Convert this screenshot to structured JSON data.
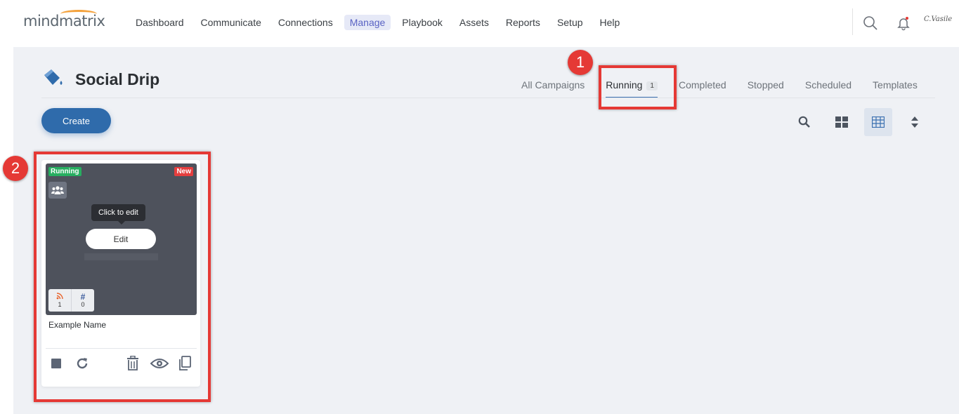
{
  "brand": {
    "logo_text": "mindmatrix",
    "signature_text": "C.Vasile"
  },
  "nav": {
    "items": [
      {
        "label": "Dashboard",
        "active": false
      },
      {
        "label": "Communicate",
        "active": false
      },
      {
        "label": "Connections",
        "active": false
      },
      {
        "label": "Manage",
        "active": true
      },
      {
        "label": "Playbook",
        "active": false
      },
      {
        "label": "Assets",
        "active": false
      },
      {
        "label": "Reports",
        "active": false
      },
      {
        "label": "Setup",
        "active": false
      },
      {
        "label": "Help",
        "active": false
      }
    ],
    "icons": [
      "search-icon",
      "bell-icon",
      "signature-avatar"
    ]
  },
  "page": {
    "title": "Social Drip",
    "title_icon": "paint-bucket-icon",
    "create_label": "Create",
    "tabs": [
      {
        "label": "All Campaigns",
        "active": false
      },
      {
        "label": "Running",
        "count": "1",
        "active": true
      },
      {
        "label": "Completed",
        "active": false
      },
      {
        "label": "Stopped",
        "active": false
      },
      {
        "label": "Scheduled",
        "active": false
      },
      {
        "label": "Templates",
        "active": false
      }
    ],
    "toolbar_icons": [
      "search-icon",
      "grid-view-icon",
      "table-view-icon",
      "sort-icon"
    ]
  },
  "card": {
    "status_badge": "Running",
    "new_badge": "New",
    "type_icon": "users-group-icon",
    "tooltip": "Click to edit",
    "edit_label": "Edit",
    "stats": [
      {
        "icon": "rss-icon",
        "value": "1"
      },
      {
        "icon": "hash-icon",
        "symbol": "#",
        "value": "0"
      }
    ],
    "name": "Example Name",
    "actions": [
      "stop-icon",
      "refresh-icon",
      "trash-icon",
      "eye-icon",
      "copy-icon"
    ]
  },
  "annotations": [
    {
      "number": "1"
    },
    {
      "number": "2"
    }
  ],
  "colors": {
    "primary": "#2f6bab",
    "nav_active_bg": "#e6e9f7",
    "nav_active_text": "#5a63c4",
    "running_green": "#27ae60",
    "new_red": "#e53e3e",
    "annotation_red": "#e53935",
    "content_bg": "#eff1f5"
  }
}
